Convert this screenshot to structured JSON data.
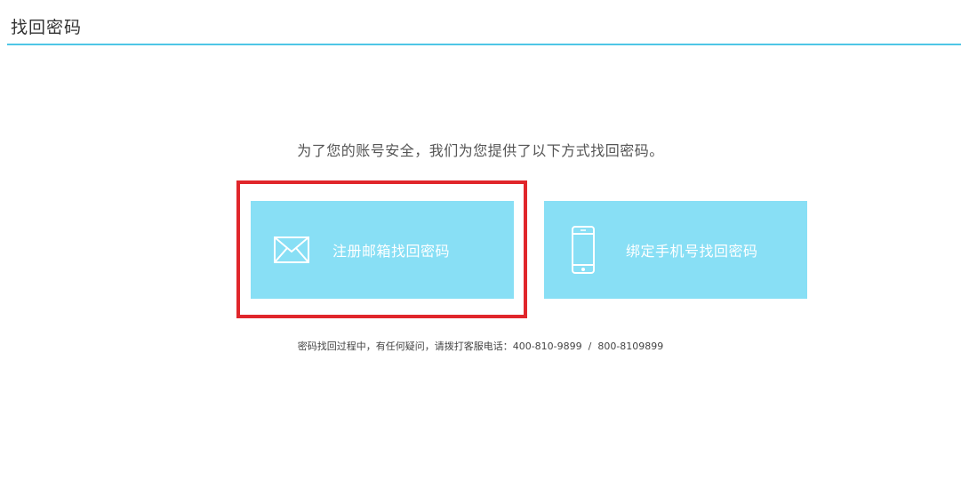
{
  "page": {
    "title": "找回密码"
  },
  "intro": {
    "text": "为了您的账号安全，我们为您提供了以下方式找回密码。"
  },
  "options": [
    {
      "label": "注册邮箱找回密码",
      "icon": "envelope-icon",
      "highlighted": true
    },
    {
      "label": "绑定手机号找回密码",
      "icon": "mobile-phone-icon",
      "highlighted": false
    }
  ],
  "help": {
    "text": "密码找回过程中，有任何疑问，请拨打客服电话：400-810-9899  /  800-8109899"
  },
  "colors": {
    "accent_line": "#4fc6e6",
    "card_background": "#88dff5",
    "highlight_border": "#e0262b",
    "card_text": "#ffffff"
  }
}
